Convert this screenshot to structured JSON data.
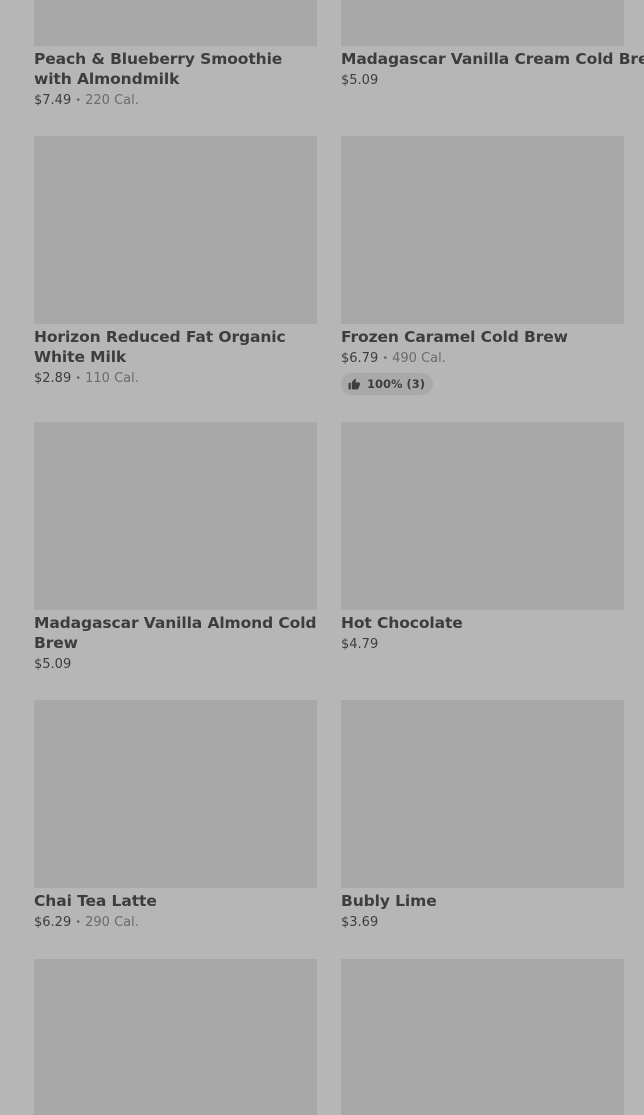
{
  "items": [
    {
      "name": "Peach & Blueberry Smoothie with Almondmilk",
      "price": "$7.49",
      "calories": "220 Cal."
    },
    {
      "name": "Madagascar Vanilla Cream Cold Brew",
      "price": "$5.09",
      "calories": ""
    },
    {
      "name": "Horizon Reduced Fat Organic White Milk",
      "price": "$2.89",
      "calories": "110 Cal."
    },
    {
      "name": "Frozen Caramel Cold Brew",
      "price": "$6.79",
      "calories": "490 Cal.",
      "rating": "100% (3)"
    },
    {
      "name": "Madagascar Vanilla Almond Cold Brew",
      "price": "$5.09",
      "calories": ""
    },
    {
      "name": "Hot Chocolate",
      "price": "$4.79",
      "calories": ""
    },
    {
      "name": "Chai Tea Latte",
      "price": "$6.29",
      "calories": "290 Cal."
    },
    {
      "name": "Bubly Lime",
      "price": "$3.69",
      "calories": ""
    },
    {
      "name": "",
      "price": "",
      "calories": ""
    },
    {
      "name": "",
      "price": "",
      "calories": ""
    }
  ],
  "icons": {
    "rating": "thumbs-up-icon"
  },
  "colors": {
    "background": "#b6b6b6",
    "image_placeholder": "#a8a8a8",
    "text": "#3d3d3d",
    "muted_text": "#6b6b6b"
  }
}
